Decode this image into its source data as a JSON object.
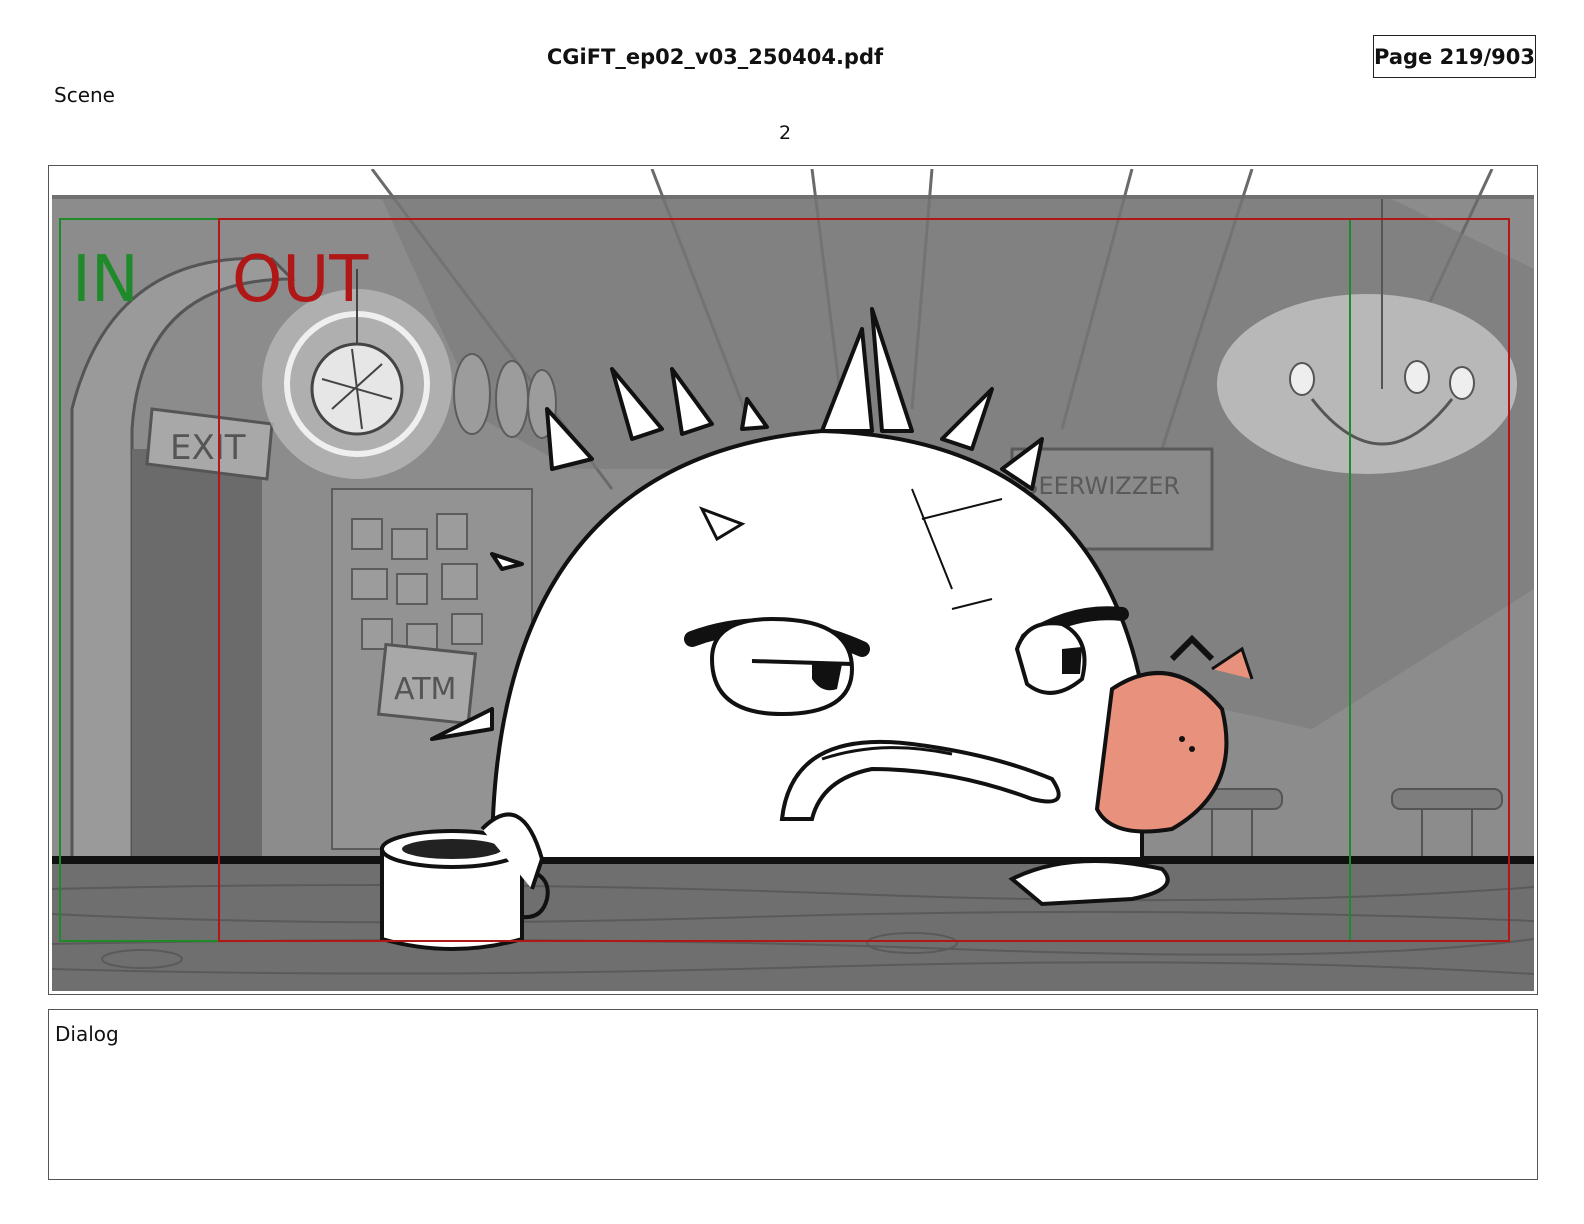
{
  "header": {
    "document_title": "CGiFT_ep02_v03_250404.pdf",
    "page_indicator": "Page 219/903"
  },
  "scene": {
    "label": "Scene",
    "number": "2"
  },
  "panel": {
    "in_label": "IN",
    "out_label": "OUT",
    "sign_exit": "EXIT",
    "sign_atm": "ATM",
    "sign_beer": "BEERWIZZER",
    "colors": {
      "in_frame": "#1f8a2a",
      "out_frame": "#b01818",
      "background_gray": "#8c8c8c",
      "counter_wood": "#6f6f6f",
      "character_pink": "#e8917c"
    }
  },
  "dialog": {
    "label": "Dialog"
  }
}
